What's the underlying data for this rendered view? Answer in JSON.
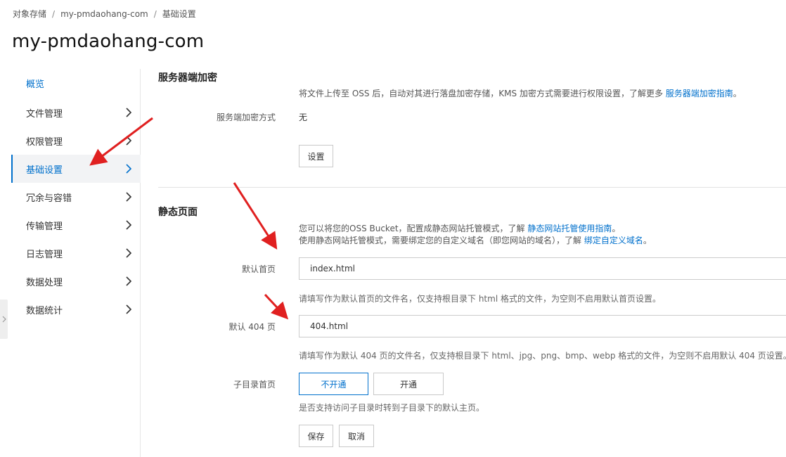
{
  "breadcrumb": {
    "items": [
      "对象存储",
      "my-pmdaohang-com",
      "基础设置"
    ],
    "separator": "/"
  },
  "page_title": "my-pmdaohang-com",
  "sidebar": {
    "items": [
      {
        "label": "概览",
        "has_chevron": false
      },
      {
        "label": "文件管理",
        "has_chevron": true
      },
      {
        "label": "权限管理",
        "has_chevron": true
      },
      {
        "label": "基础设置",
        "has_chevron": true,
        "active": true
      },
      {
        "label": "冗余与容错",
        "has_chevron": true
      },
      {
        "label": "传输管理",
        "has_chevron": true
      },
      {
        "label": "日志管理",
        "has_chevron": true
      },
      {
        "label": "数据处理",
        "has_chevron": true
      },
      {
        "label": "数据统计",
        "has_chevron": true
      }
    ]
  },
  "encryption": {
    "title": "服务器端加密",
    "desc_text": "将文件上传至 OSS 后，自动对其进行落盘加密存储，KMS 加密方式需要进行权限设置，了解更多 ",
    "desc_link": "服务器端加密指南",
    "desc_end": "。",
    "method_label": "服务端加密方式",
    "method_value": "无",
    "settings_button": "设置"
  },
  "static_page": {
    "title": "静态页面",
    "desc1_text": "您可以将您的OSS Bucket，配置成静态网站托管模式，了解 ",
    "desc1_link": "静态网站托管使用指南",
    "desc1_end": "。",
    "desc2_text": "使用静态网站托管模式，需要绑定您的自定义域名（即您网站的域名），了解 ",
    "desc2_link": "绑定自定义域名",
    "desc2_end": "。",
    "index_label": "默认首页",
    "index_value": "index.html",
    "index_hint": "请填写作为默认首页的文件名，仅支持根目录下 html 格式的文件，为空则不启用默认首页设置。",
    "error_label": "默认 404 页",
    "error_value": "404.html",
    "error_hint": "请填写作为默认 404 页的文件名，仅支持根目录下 html、jpg、png、bmp、webp 格式的文件，为空则不启用默认 404 页设置。",
    "subdir_label": "子目录首页",
    "subdir_options": [
      "不开通",
      "开通"
    ],
    "subdir_selected": "不开通",
    "subdir_hint": "是否支持访问子目录时转到子目录下的默认主页。",
    "save_button": "保存",
    "cancel_button": "取消"
  },
  "colors": {
    "accent": "#0070cc",
    "annotation_arrow": "#e02020"
  }
}
